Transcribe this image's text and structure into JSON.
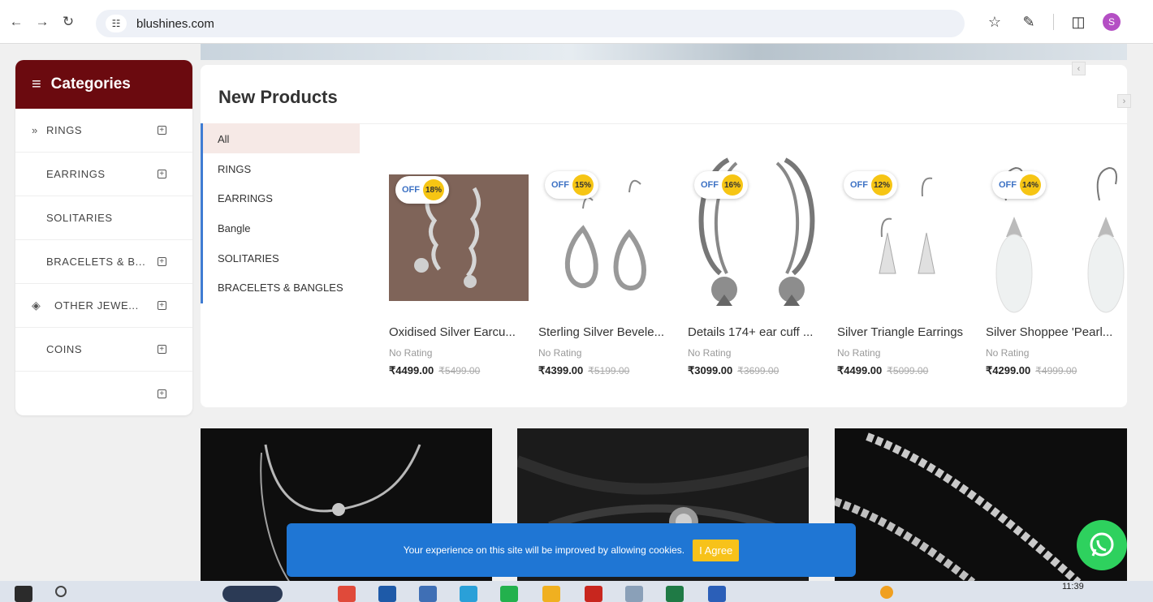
{
  "browser": {
    "url": "blushines.com",
    "profile_initial": "S"
  },
  "categories": {
    "title": "Categories",
    "items": [
      {
        "label": "RINGS",
        "prefix": "»",
        "expandable": true
      },
      {
        "label": "EARRINGS",
        "prefix": "",
        "expandable": true
      },
      {
        "label": "SOLITARIES",
        "prefix": "",
        "expandable": false
      },
      {
        "label": "BRACELETS & B...",
        "prefix": "",
        "expandable": true
      },
      {
        "label": "OTHER JEWE...",
        "prefix": "diamond-icon",
        "expandable": true
      },
      {
        "label": "COINS",
        "prefix": "",
        "expandable": true
      },
      {
        "label": "",
        "prefix": "",
        "expandable": true
      }
    ]
  },
  "new_products": {
    "title": "New Products",
    "filters": [
      "All",
      "RINGS",
      "EARRINGS",
      "Bangle",
      "SOLITARIES",
      "BRACELETS & BANGLES"
    ],
    "active_filter": "All",
    "products": [
      {
        "name": "Oxidised Silver Earcu...",
        "off_label": "OFF",
        "discount": "18%",
        "rating": "No Rating",
        "price": "₹4499.00",
        "old_price": "₹5499.00"
      },
      {
        "name": "Sterling Silver Bevele...",
        "off_label": "OFF",
        "discount": "15%",
        "rating": "No Rating",
        "price": "₹4399.00",
        "old_price": "₹5199.00"
      },
      {
        "name": "Details 174+ ear cuff ...",
        "off_label": "OFF",
        "discount": "16%",
        "rating": "No Rating",
        "price": "₹3099.00",
        "old_price": "₹3699.00"
      },
      {
        "name": "Silver Triangle Earrings",
        "off_label": "OFF",
        "discount": "12%",
        "rating": "No Rating",
        "price": "₹4499.00",
        "old_price": "₹5099.00"
      },
      {
        "name": "Silver Shoppee 'Pearl...",
        "off_label": "OFF",
        "discount": "14%",
        "rating": "No Rating",
        "price": "₹4299.00",
        "old_price": "₹4999.00"
      }
    ]
  },
  "cookie": {
    "message": "Your experience on this site will be improved by allowing cookies.",
    "button": "I Agree"
  },
  "taskbar": {
    "time": "11:39"
  }
}
